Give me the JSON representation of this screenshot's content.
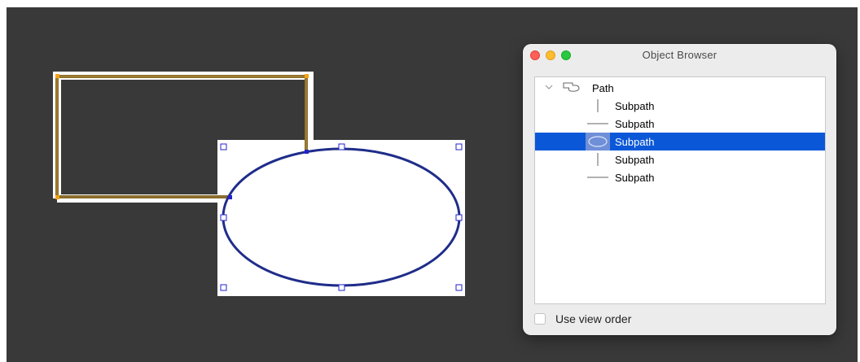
{
  "panel": {
    "title": "Object Browser",
    "window_buttons": [
      "close",
      "minimize",
      "zoom"
    ]
  },
  "outline": {
    "root": {
      "label": "Path",
      "expanded": true,
      "icon": "path-shape-icon",
      "toggle_icon": "chevron-down-icon"
    },
    "items": [
      {
        "label": "Subpath",
        "icon": "vertical-line-icon",
        "selected": false
      },
      {
        "label": "Subpath",
        "icon": "horizontal-line-icon",
        "selected": false
      },
      {
        "label": "Subpath",
        "icon": "ellipse-arc-icon",
        "selected": true
      },
      {
        "label": "Subpath",
        "icon": "vertical-line-icon",
        "selected": false
      },
      {
        "label": "Subpath",
        "icon": "horizontal-line-icon",
        "selected": false
      }
    ]
  },
  "footer": {
    "view_order_label": "Use view order",
    "view_order_checked": false
  },
  "colors": {
    "canvas": "#393939",
    "selection": "#0a58d8",
    "path_stroke": "#8a6d2c",
    "ellipse_stroke": "#1f2d8a",
    "handle": "#2222cc"
  }
}
